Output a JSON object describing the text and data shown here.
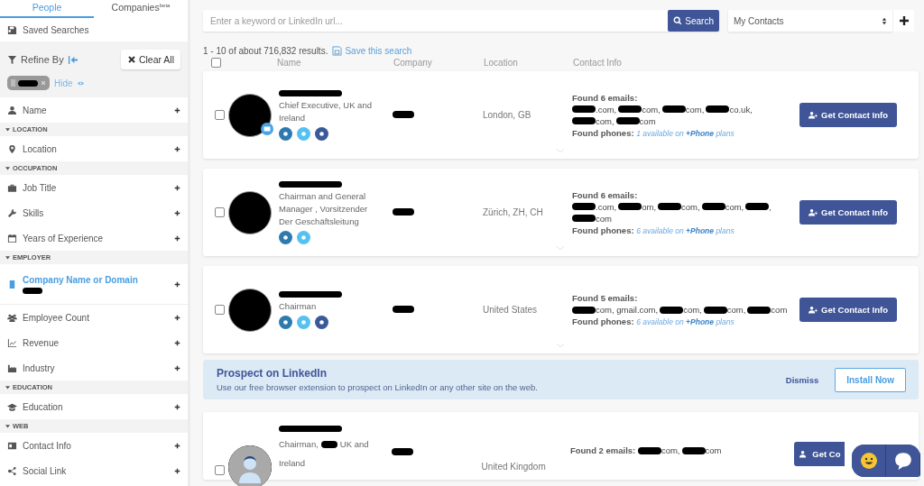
{
  "tabs": [
    {
      "label": "People",
      "selected": true
    },
    {
      "label": "Companies",
      "selected": false,
      "sup": "beta"
    }
  ],
  "saved_searches": "Saved Searches",
  "refine": {
    "title": "Refine By",
    "clear": "Clear All",
    "hide": "Hide"
  },
  "filters": [
    {
      "kind": "filter",
      "label": "Name",
      "active": false
    },
    {
      "kind": "header",
      "label": "LOCATION",
      "expanded": true
    },
    {
      "kind": "filter",
      "label": "Location",
      "active": false
    },
    {
      "kind": "header",
      "label": "OCCUPATION",
      "expanded": true
    },
    {
      "kind": "filter",
      "label": "Job Title",
      "active": false
    },
    {
      "kind": "filter",
      "label": "Skills",
      "active": false
    },
    {
      "kind": "filter",
      "label": "Years of Experience",
      "active": false
    },
    {
      "kind": "header",
      "label": "EMPLOYER",
      "expanded": true
    },
    {
      "kind": "filter",
      "label": "Company Name or Domain",
      "active": true
    },
    {
      "kind": "filter",
      "label": "Employee Count",
      "active": false
    },
    {
      "kind": "filter",
      "label": "Revenue",
      "active": false
    },
    {
      "kind": "filter",
      "label": "Industry",
      "active": false
    },
    {
      "kind": "header",
      "label": "EDUCATION",
      "expanded": true
    },
    {
      "kind": "filter",
      "label": "Education",
      "active": false
    },
    {
      "kind": "header",
      "label": "WEB",
      "expanded": true
    },
    {
      "kind": "filter",
      "label": "Contact Info",
      "active": false
    },
    {
      "kind": "filter",
      "label": "Social Link",
      "active": false
    }
  ],
  "search": {
    "placeholder": "Enter a keyword or LinkedIn url...",
    "button": "Search",
    "list": "My Contacts"
  },
  "results_summary": "1 - 10 of about 716,832 results.",
  "save_search": "Save this search",
  "select_all": {
    "checked": false
  },
  "columns": [
    "Name",
    "Company",
    "Location",
    "Contact Info"
  ],
  "results": [
    {
      "checked": false,
      "title": "Chief Executive, UK and Ireland",
      "badge": true,
      "social": [
        {
          "kind": "linkedin"
        },
        {
          "kind": "twitter"
        },
        {
          "kind": "facebook"
        }
      ],
      "location": "London, GB",
      "emails_label": "Found 6 emails:",
      "emails": [
        ".com,",
        "com,",
        "com,",
        "co.uk,",
        "com,",
        "com"
      ],
      "phones_label": "Found phones:",
      "phones": "1 available on",
      "phones_plan": "+Phone",
      "phones_tail": "plans",
      "button": "Get Contact Info"
    },
    {
      "checked": false,
      "title": "Chairman and General Manager , Vorsitzender Der Geschäftsleitung",
      "badge": false,
      "social": [
        {
          "kind": "linkedin"
        },
        {
          "kind": "twitter"
        }
      ],
      "location": "Zürich, ZH, CH",
      "emails_label": "Found 6 emails:",
      "emails": [
        ".com,",
        "om,",
        "com,",
        "com,",
        ",",
        "com"
      ],
      "phones_label": "Found phones:",
      "phones": "6 available on",
      "phones_plan": "+Phone",
      "phones_tail": "plans",
      "button": "Get Contact Info"
    },
    {
      "checked": false,
      "title": "Chairman",
      "badge": false,
      "social": [
        {
          "kind": "linkedin"
        },
        {
          "kind": "twitter"
        },
        {
          "kind": "facebook"
        }
      ],
      "location": "United States",
      "emails_label": "Found 5 emails:",
      "emails": [
        "com, gmail.com,",
        "com,",
        "com,",
        "com"
      ],
      "phones_label": "Found phones:",
      "phones": "6 available on",
      "phones_plan": "+Phone",
      "phones_tail": "plans",
      "button": "Get Contact Info"
    }
  ],
  "banner": {
    "title": "Prospect on LinkedIn",
    "text": "Use our free browser extension to prospect on LinkedIn or any other site on the web.",
    "dismiss": "Dismiss",
    "install": "Install Now"
  },
  "last_result": {
    "checked": false,
    "title_start": "Chairman,",
    "title_mid": "UK and",
    "title_end": "Ireland",
    "location": "United Kingdom",
    "emails_label": "Found 2 emails:",
    "emails": [
      "com,",
      "com"
    ],
    "button": "Get Co"
  }
}
